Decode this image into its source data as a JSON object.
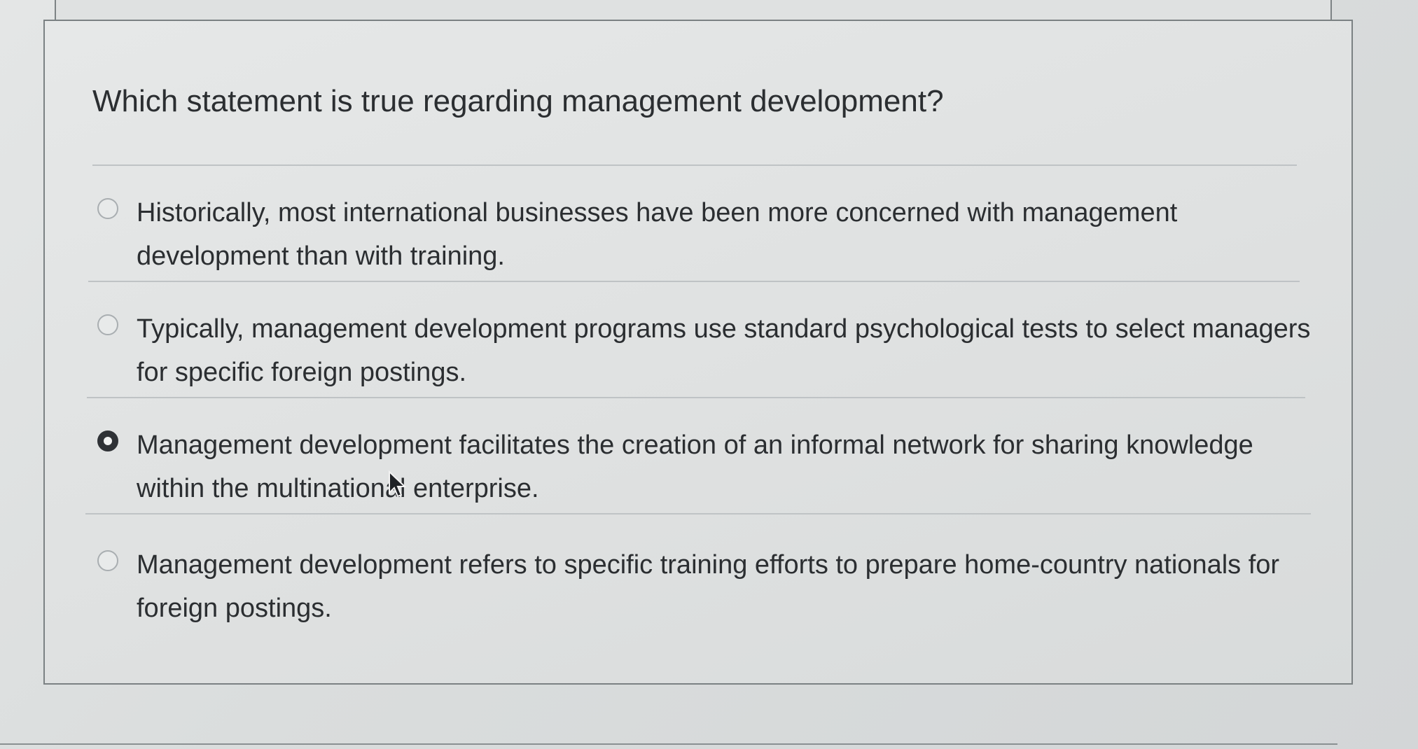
{
  "question": {
    "text": "Which statement is true regarding management development?"
  },
  "options": [
    {
      "text": "Historically, most international businesses have been more concerned with management development than with training.",
      "selected": false
    },
    {
      "text": "Typically, management development programs use standard psychological tests to select managers for specific foreign postings.",
      "selected": false
    },
    {
      "text": "Management development facilitates the creation of an informal network for sharing knowledge within the multinational enterprise.",
      "selected": true
    },
    {
      "text": "Management development refers to specific training efforts to prepare home-country nationals for foreign postings.",
      "selected": false
    }
  ],
  "cursor": {
    "icon": "mouse-pointer-icon"
  },
  "colors": {
    "text": "#2b2e31",
    "border": "#7b8183",
    "radio_selected": "#2f3236"
  }
}
